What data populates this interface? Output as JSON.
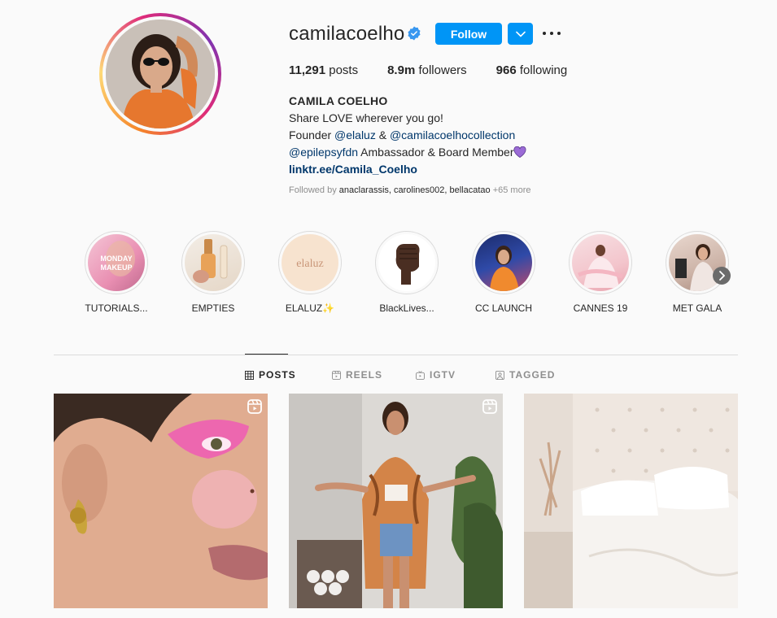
{
  "profile": {
    "username": "camilacoelho",
    "follow_label": "Follow",
    "stats": [
      {
        "value": "11,291",
        "label": "posts"
      },
      {
        "value": "8.9m",
        "label": "followers"
      },
      {
        "value": "966",
        "label": "following"
      }
    ],
    "full_name": "CAMILA COELHO",
    "bio_line1": "Share LOVE wherever you go!",
    "bio_founder": "Founder",
    "bio_mention1": "@elaluz",
    "bio_amp": "&",
    "bio_mention2": "@camilacoelhocollection",
    "bio_mention3": "@epilepsyfdn",
    "bio_ambassador": "Ambassador & Board Member",
    "bio_url": "linktr.ee/Camila_Coelho",
    "followed_by_prefix": "Followed by",
    "followed_by_names": "anaclarassis, carolines002, bellacatao",
    "followed_by_more": "+65 more"
  },
  "highlights": [
    {
      "label": "TUTORIALS...",
      "overlay": "MONDAY MAKEUP"
    },
    {
      "label": "EMPTIES"
    },
    {
      "label": "ELALUZ✨",
      "overlay": "elaluz"
    },
    {
      "label": "BlackLives..."
    },
    {
      "label": "CC LAUNCH"
    },
    {
      "label": "CANNES 19"
    },
    {
      "label": "MET GALA"
    }
  ],
  "tabs": [
    {
      "label": "POSTS",
      "icon": "grid-icon",
      "active": true
    },
    {
      "label": "REELS",
      "icon": "reels-icon",
      "active": false
    },
    {
      "label": "IGTV",
      "icon": "igtv-icon",
      "active": false
    },
    {
      "label": "TAGGED",
      "icon": "tagged-icon",
      "active": false
    }
  ],
  "posts": [
    {
      "type": "reel",
      "icon": "reel-icon"
    },
    {
      "type": "reel",
      "icon": "reel-icon"
    },
    {
      "type": "photo"
    }
  ],
  "colors": {
    "accent": "#0095f6",
    "link": "#00376b",
    "text": "#262626",
    "muted": "#8e8e8e",
    "background": "#fafafa"
  }
}
